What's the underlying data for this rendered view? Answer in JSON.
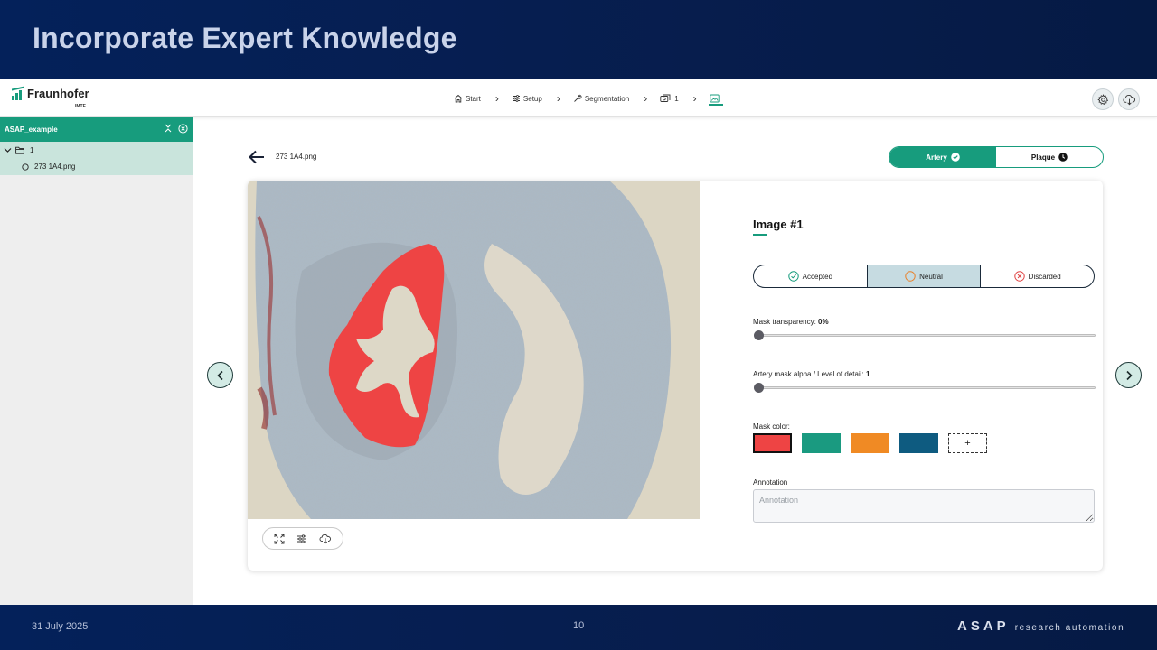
{
  "slide": {
    "title": "Incorporate Expert Knowledge",
    "date": "31 July 2025",
    "page_number": "10",
    "brand_main": "ASAP",
    "brand_sub": "research automation"
  },
  "logo": {
    "name": "Fraunhofer",
    "sub": "IMTE",
    "color": "#179c7d"
  },
  "steps": [
    {
      "label": "Start",
      "icon": "home-icon"
    },
    {
      "label": "Setup",
      "icon": "sliders-icon"
    },
    {
      "label": "Segmentation",
      "icon": "wrench-icon"
    },
    {
      "label": "1",
      "icon": "stack-icon"
    },
    {
      "label": "",
      "icon": "image-icon",
      "active": true
    }
  ],
  "top_actions": [
    {
      "icon": "gear-icon"
    },
    {
      "icon": "cloud-download-icon"
    }
  ],
  "sidebar": {
    "project": "ASAP_example",
    "folder": "1",
    "file": "273 1A4.png"
  },
  "main": {
    "filename": "273 1A4.png",
    "toggle": [
      {
        "label": "Artery",
        "state": "done"
      },
      {
        "label": "Plaque",
        "state": "pending"
      }
    ]
  },
  "panel": {
    "title": "Image #1",
    "status": [
      {
        "label": "Accepted",
        "icon": "check-circle-icon",
        "color": "#179c7d"
      },
      {
        "label": "Neutral",
        "icon": "circle-icon",
        "color": "#e8812b",
        "selected": true
      },
      {
        "label": "Discarded",
        "icon": "x-circle-icon",
        "color": "#e04545"
      }
    ],
    "mask_transparency_label": "Mask transparency: ",
    "mask_transparency_value": "0%",
    "mask_transparency": 0,
    "alpha_label": "Artery mask alpha / Level of detail: ",
    "alpha_value": "1",
    "alpha_fraction": 0,
    "mask_color_label": "Mask color:",
    "mask_colors": [
      "#ee4444",
      "#1a9a80",
      "#f08a24",
      "#0e5b80"
    ],
    "add_color_label": "+",
    "annotation_label": "Annotation",
    "annotation_placeholder": "Annotation"
  }
}
